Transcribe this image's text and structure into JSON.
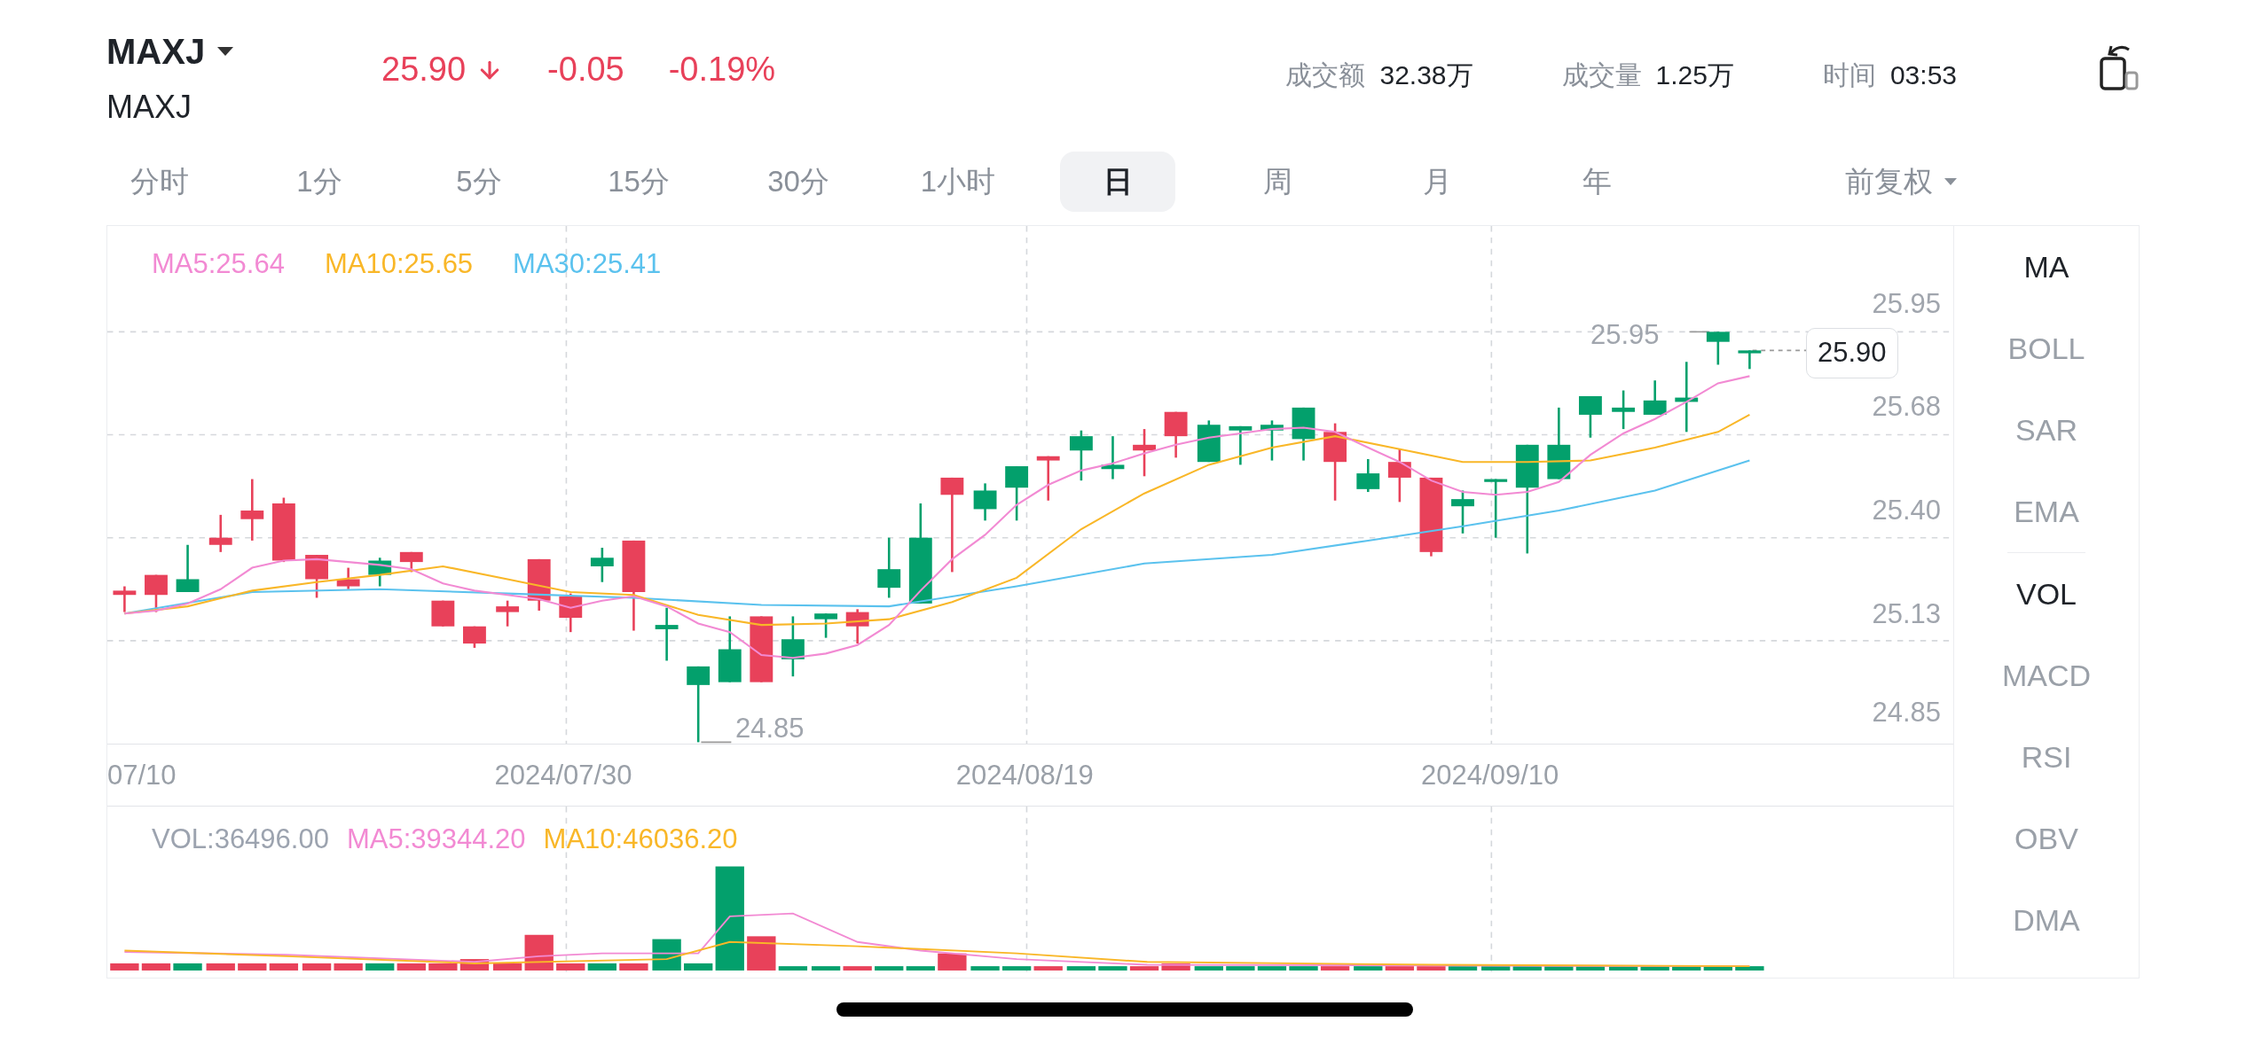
{
  "header": {
    "symbol": "MAXJ",
    "name": "MAXJ",
    "price": "25.90",
    "falling": true,
    "change": "-0.05",
    "change_pct": "-0.19%",
    "stats": [
      {
        "label": "成交额",
        "value": "32.38万"
      },
      {
        "label": "成交量",
        "value": "1.25万"
      },
      {
        "label": "时间",
        "value": "03:53"
      }
    ]
  },
  "periods": [
    {
      "label": "分时",
      "selected": false
    },
    {
      "label": "1分",
      "selected": false
    },
    {
      "label": "5分",
      "selected": false
    },
    {
      "label": "15分",
      "selected": false
    },
    {
      "label": "30分",
      "selected": false
    },
    {
      "label": "1小时",
      "selected": false
    },
    {
      "label": "日",
      "selected": true
    },
    {
      "label": "周",
      "selected": false
    },
    {
      "label": "月",
      "selected": false
    },
    {
      "label": "年",
      "selected": false
    }
  ],
  "adjust": "前复权",
  "main_chart": {
    "legend": [
      {
        "label": "MA5:25.64",
        "color": "#f28ad3"
      },
      {
        "label": "MA10:25.65",
        "color": "#f9b728"
      },
      {
        "label": "MA30:25.41",
        "color": "#5bc2ee"
      }
    ],
    "y_labels": [
      "25.95",
      "25.68",
      "25.40",
      "25.13",
      "24.85"
    ],
    "high_label": "25.95",
    "low_label": "24.85",
    "last_price": "25.90",
    "x_labels": [
      "07/10",
      "2024/07/30",
      "2024/08/19",
      "2024/09/10"
    ]
  },
  "volume_chart": {
    "legend": [
      {
        "label": "VOL:36496.00",
        "color": "#9ca3af"
      },
      {
        "label": "MA5:39344.20",
        "color": "#f28ad3"
      },
      {
        "label": "MA10:46036.20",
        "color": "#f9b728"
      }
    ]
  },
  "main_indicators": [
    {
      "label": "MA",
      "selected": true
    },
    {
      "label": "BOLL",
      "selected": false
    },
    {
      "label": "SAR",
      "selected": false
    },
    {
      "label": "EMA",
      "selected": false
    }
  ],
  "sub_indicators": [
    {
      "label": "VOL",
      "selected": true
    },
    {
      "label": "MACD",
      "selected": false
    },
    {
      "label": "RSI",
      "selected": false
    },
    {
      "label": "OBV",
      "selected": false
    },
    {
      "label": "DMA",
      "selected": false
    }
  ]
}
